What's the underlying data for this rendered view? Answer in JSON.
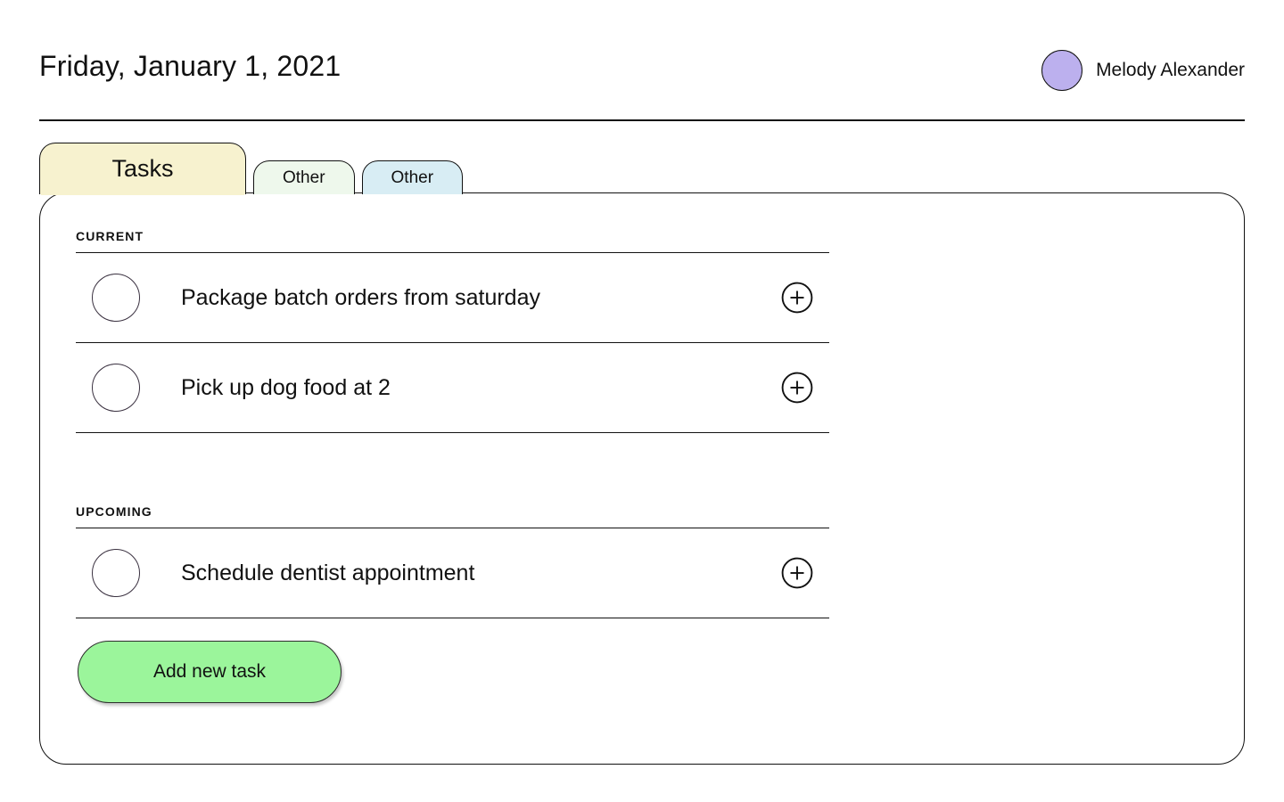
{
  "header": {
    "date_title": "Friday, January 1, 2021",
    "user_name": "Melody Alexander",
    "avatar_color": "#bcb0ee"
  },
  "tabs": [
    {
      "label": "Tasks",
      "active": true,
      "color": "#f7f2cf"
    },
    {
      "label": "Other",
      "active": false,
      "color": "#eef8ec"
    },
    {
      "label": "Other",
      "active": false,
      "color": "#d8edf4"
    }
  ],
  "sections": [
    {
      "label": "CURRENT",
      "tasks": [
        {
          "text": "Package batch orders from saturday",
          "checked": false,
          "add_icon": "plus-circle-icon"
        },
        {
          "text": "Pick up dog food at 2",
          "checked": false,
          "add_icon": "plus-circle-icon"
        }
      ]
    },
    {
      "label": "UPCOMING",
      "tasks": [
        {
          "text": "Schedule dentist appointment",
          "checked": false,
          "add_icon": "plus-circle-icon"
        }
      ]
    }
  ],
  "actions": {
    "add_new_task_label": "Add new task",
    "add_new_task_color": "#9bf59b"
  }
}
